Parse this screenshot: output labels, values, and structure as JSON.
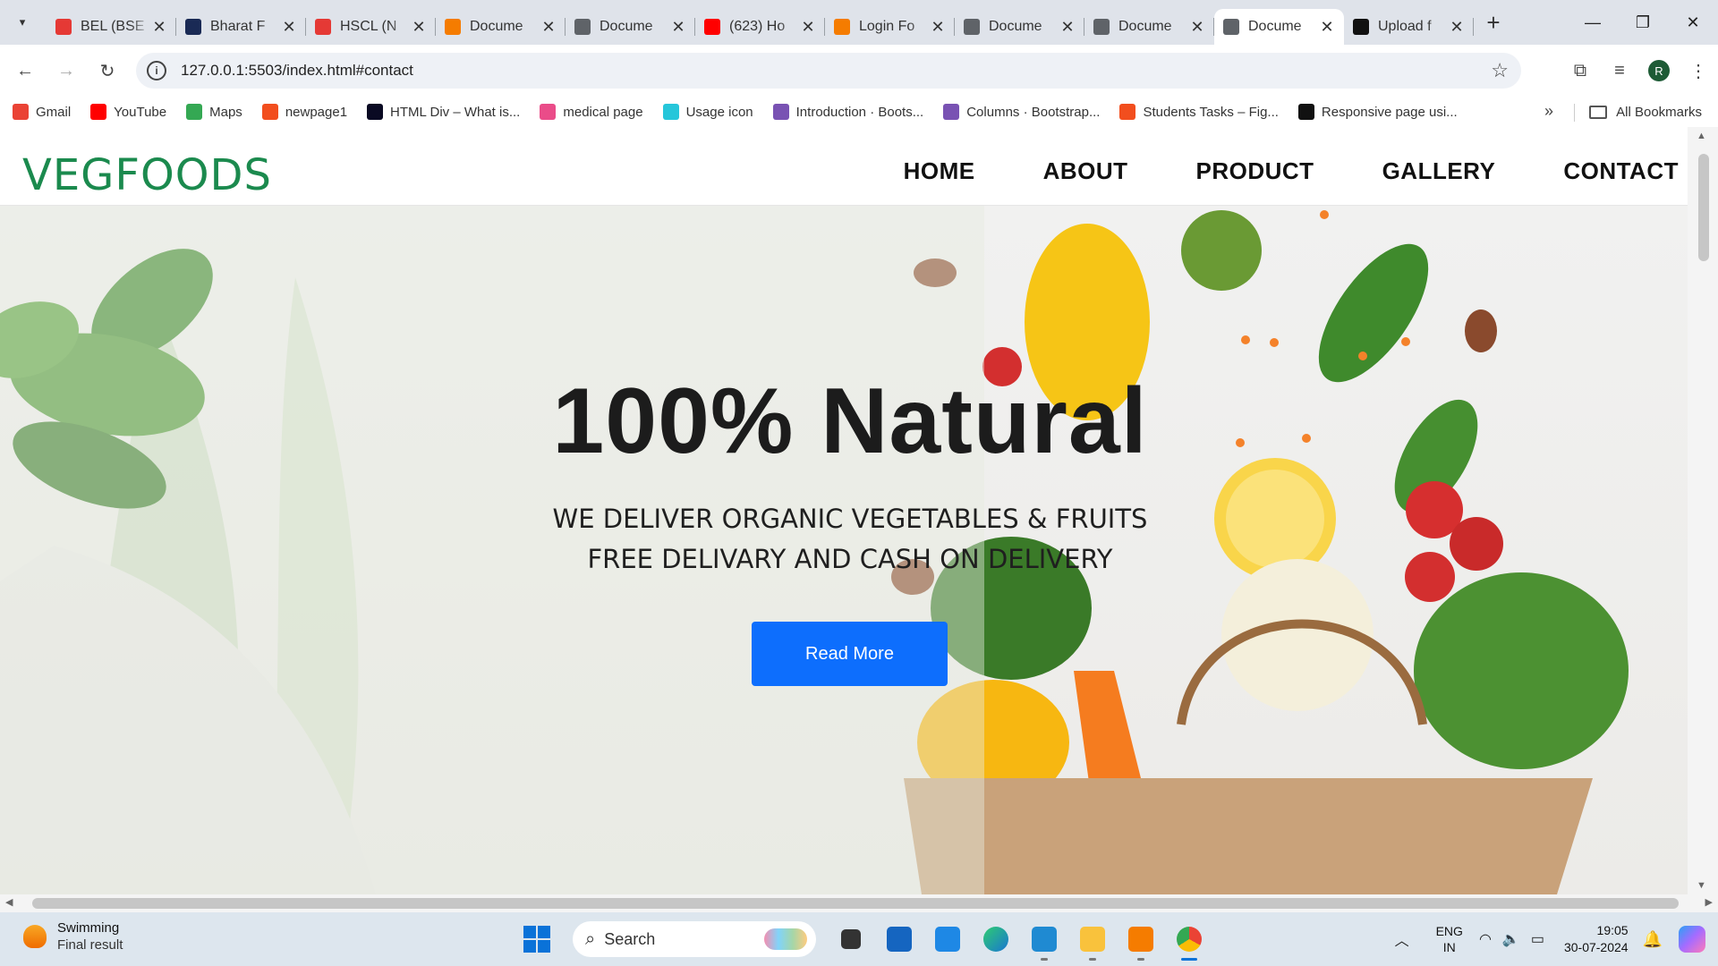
{
  "browser": {
    "tabs": [
      {
        "title": "BEL (BSE",
        "favicon": "red-k-icon",
        "color": "#e53935"
      },
      {
        "title": "Bharat F",
        "favicon": "bse-icon",
        "color": "#1a2a55"
      },
      {
        "title": "HSCL (N",
        "favicon": "red-k-icon",
        "color": "#e53935"
      },
      {
        "title": "Docume",
        "favicon": "xampp-icon",
        "color": "#f57c00"
      },
      {
        "title": "Docume",
        "favicon": "globe-icon",
        "color": "#5f6368"
      },
      {
        "title": "(623) Ho",
        "favicon": "youtube-icon",
        "color": "#ff0000"
      },
      {
        "title": "Login Fo",
        "favicon": "xampp-icon",
        "color": "#f57c00"
      },
      {
        "title": "Docume",
        "favicon": "globe-icon",
        "color": "#5f6368"
      },
      {
        "title": "Docume",
        "favicon": "globe-icon",
        "color": "#5f6368"
      },
      {
        "title": "Docume",
        "favicon": "globe-icon",
        "color": "#5f6368",
        "active": true
      },
      {
        "title": "Upload f",
        "favicon": "github-icon",
        "color": "#111111"
      }
    ],
    "url": "127.0.0.1:5503/index.html#contact",
    "profile_initial": "R",
    "bookmarks": [
      {
        "label": "Gmail",
        "icon": "gmail-icon",
        "color": "#ea4335"
      },
      {
        "label": "YouTube",
        "icon": "youtube-icon",
        "color": "#ff0000"
      },
      {
        "label": "Maps",
        "icon": "maps-icon",
        "color": "#34a853"
      },
      {
        "label": "newpage1",
        "icon": "figma-icon",
        "color": "#f24e1e"
      },
      {
        "label": "HTML Div – What is...",
        "icon": "freecodecamp-icon",
        "color": "#0a0a23"
      },
      {
        "label": "medical page",
        "icon": "dribbble-icon",
        "color": "#ea4c89"
      },
      {
        "label": "Usage icon",
        "icon": "cube-icon",
        "color": "#26c6da"
      },
      {
        "label": "Introduction · Boots...",
        "icon": "bootstrap-icon",
        "color": "#7952b3"
      },
      {
        "label": "Columns · Bootstrap...",
        "icon": "bootstrap-icon",
        "color": "#7952b3"
      },
      {
        "label": "Students Tasks – Fig...",
        "icon": "figma-icon",
        "color": "#f24e1e"
      },
      {
        "label": "Responsive page usi...",
        "icon": "github-icon",
        "color": "#111111"
      }
    ],
    "all_bookmarks": "All Bookmarks"
  },
  "site": {
    "logo": "VEGFOODS",
    "nav": [
      "HOME",
      "ABOUT",
      "PRODUCT",
      "GALLERY",
      "CONTACT"
    ],
    "hero": {
      "heading": "100% Natural",
      "subtitle": "WE DELIVER ORGANIC VEGETABLES & FRUITS FREE DELIVARY AND CASH ON DELIVERY",
      "button": "Read More"
    },
    "accent": "#1b8a4e",
    "button_color": "#0d6efd"
  },
  "taskbar": {
    "weather_title": "Swimming",
    "weather_sub": "Final result",
    "search_placeholder": "Search",
    "lang_line1": "ENG",
    "lang_line2": "IN",
    "time": "19:05",
    "date": "30-07-2024"
  }
}
